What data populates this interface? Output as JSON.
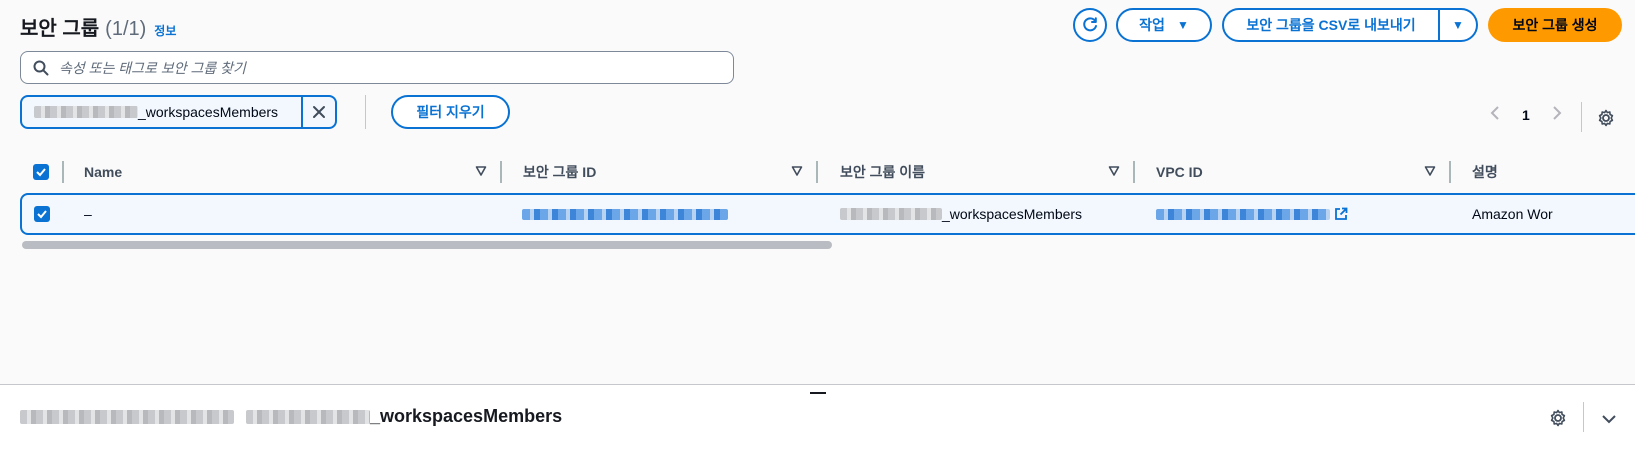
{
  "header": {
    "title": "보안 그룹",
    "count": "(1/1)",
    "info_link": "정보"
  },
  "toolbar": {
    "actions_label": "작업",
    "export_label": "보안 그룹을 CSV로 내보내기",
    "create_label": "보안 그룹 생성"
  },
  "search": {
    "placeholder": "속성 또는 태그로 보안 그룹 찾기",
    "value": ""
  },
  "filter": {
    "token_suffix": "_workspacesMembers",
    "clear_label": "필터 지우기"
  },
  "pagination": {
    "current_page": "1"
  },
  "table": {
    "columns": [
      "Name",
      "보안 그룹 ID",
      "보안 그룹 이름",
      "VPC ID",
      "설명"
    ],
    "rows": [
      {
        "selected": true,
        "name": "–",
        "group_name_suffix": "_workspacesMembers",
        "description": "Amazon Wor"
      }
    ]
  },
  "details_panel": {
    "title_suffix": "_workspacesMembers"
  },
  "colors": {
    "accent": "#0972d3",
    "primary_button": "#ff9900",
    "selected_row_bg": "#f2f8fd"
  }
}
